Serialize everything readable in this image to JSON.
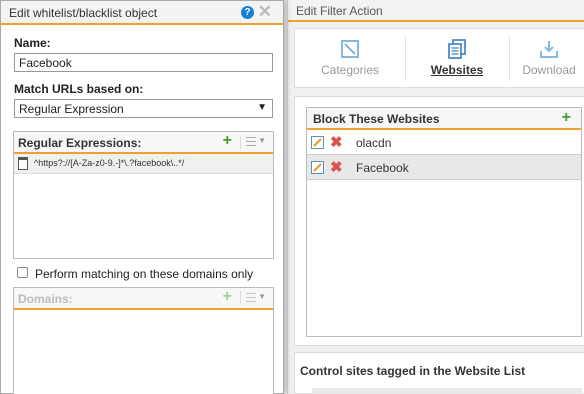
{
  "right": {
    "header": "Edit Filter Action",
    "toolbar": [
      {
        "label": "Categories",
        "icon": "categories-icon"
      },
      {
        "label": "Websites",
        "icon": "websites-icon",
        "active": true
      },
      {
        "label": "Download",
        "icon": "download-icon"
      }
    ],
    "block_list": {
      "title": "Block These Websites",
      "rows": [
        "olacdn",
        "Facebook"
      ],
      "selected_row": "Facebook"
    },
    "control_title": "Control sites tagged in the Website List"
  },
  "dialog": {
    "title": "Edit whitelist/blacklist object",
    "name_label": "Name:",
    "name_value": "Facebook",
    "match_label": "Match URLs based on:",
    "match_value": "Regular Expression",
    "regex_panel": {
      "title": "Regular Expressions:",
      "rows": [
        "^https?://[A-Za-z0-9.-]*\\.?facebook\\..*/"
      ]
    },
    "domains_only_label": "Perform matching on these domains only",
    "domains_only_checked": false,
    "domains_panel": {
      "title": "Domains:"
    }
  },
  "colors": {
    "accent": "#f0a030",
    "add_green": "#4a9a2a",
    "delete_red": "#d9534f",
    "help_blue": "#1a7fd0"
  }
}
